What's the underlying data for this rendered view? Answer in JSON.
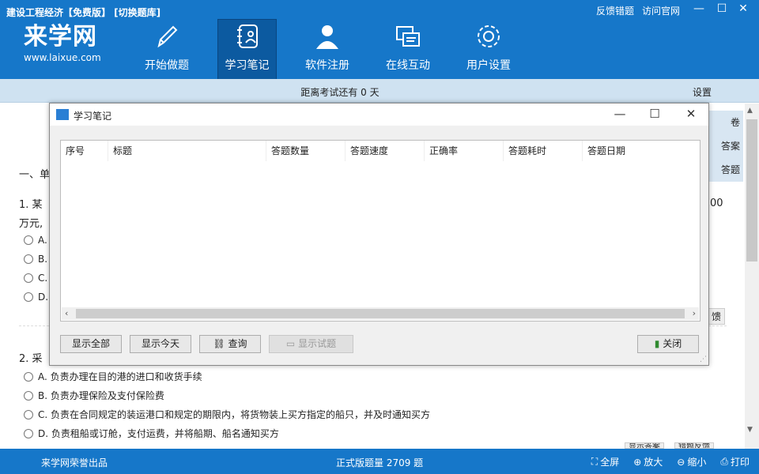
{
  "app": {
    "title": "建设工程经济【免费版】 [切换题库]",
    "top_links": [
      "反馈错题",
      "访问官网"
    ],
    "win_controls": [
      "—",
      "☐",
      "✕"
    ]
  },
  "logo": {
    "main": "来学网",
    "sub": "www.laixue.com"
  },
  "nav": [
    {
      "label": "开始做题",
      "icon": "pencil-icon"
    },
    {
      "label": "学习笔记",
      "icon": "notebook-icon",
      "active": true
    },
    {
      "label": "软件注册",
      "icon": "user-icon"
    },
    {
      "label": "在线互动",
      "icon": "chat-icon"
    },
    {
      "label": "用户设置",
      "icon": "gear-icon"
    }
  ],
  "countdown": "距离考试还有 0 天",
  "settings_label": "设置",
  "side_tabs": [
    "卷",
    "答案",
    "答题"
  ],
  "background": {
    "section": "一、单",
    "q1_start": "1. 某",
    "q1_cont": "万元,",
    "q1_right": "00",
    "q1_options": [
      "A.",
      "B.",
      "C.",
      "D."
    ],
    "report_btn": "馈",
    "q2_start": "2. 采",
    "q2_options": [
      "A. 负责办理在目的港的进口和收货手续",
      "B. 负责办理保险及支付保险费",
      "C. 负责在合同规定的装运港口和规定的期限内，将货物装上买方指定的船只，并及时通知买方",
      "D. 负责租船或订舱，支付运费，并将船期、船名通知买方"
    ],
    "q2_btns": [
      "显示答案",
      "错题反馈"
    ]
  },
  "modal": {
    "title": "学习笔记",
    "columns": [
      "序号",
      "标题",
      "答题数量",
      "答题速度",
      "正确率",
      "答题耗时",
      "答题日期"
    ],
    "buttons": {
      "show_all": "显示全部",
      "show_today": "显示今天",
      "query": "查询",
      "show_question": "显示试题",
      "close": "关闭"
    }
  },
  "status": {
    "left": "来学网荣誉出品",
    "center": "正式版题量 2709 题",
    "buttons": [
      "全屏",
      "放大",
      "缩小",
      "打印"
    ]
  },
  "colors": {
    "header": "#1677c9",
    "active_nav": "#0c5aa0",
    "countdown_bar": "#cfe2f1"
  }
}
